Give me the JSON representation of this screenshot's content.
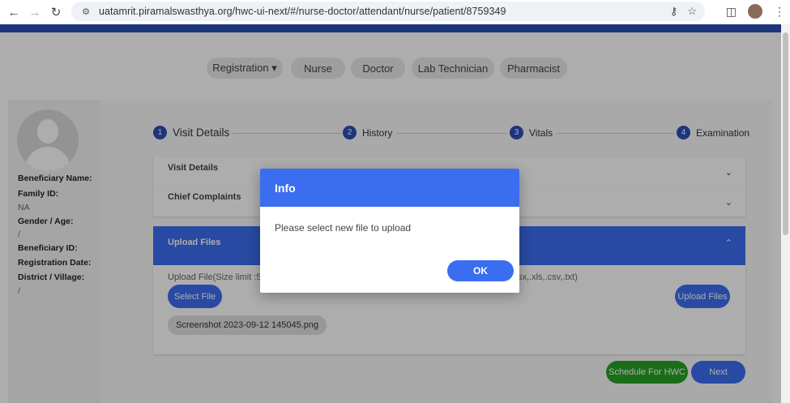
{
  "browser": {
    "url": "uatamrit.piramalswasthya.org/hwc-ui-next/#/nurse-doctor/attendant/nurse/patient/8759349"
  },
  "tabs": [
    "Registration ▾",
    "Nurse",
    "Doctor",
    "Lab Technician",
    "Pharmacist"
  ],
  "beneficiary": {
    "name_label": "Beneficiary Name:",
    "family_label": "Family ID:",
    "family_value": "NA",
    "gender_label": "Gender / Age:",
    "gender_value": "/",
    "benid_label": "Beneficiary ID:",
    "regdate_label": "Registration Date:",
    "district_label": "District / Village:",
    "district_value": "/"
  },
  "steps": [
    {
      "num": "1",
      "label": "Visit Details"
    },
    {
      "num": "2",
      "label": "History"
    },
    {
      "num": "3",
      "label": "Vitals"
    },
    {
      "num": "4",
      "label": "Examination"
    }
  ],
  "sections": {
    "visit_details": "Visit Details",
    "chief_complaints": "Chief Complaints",
    "upload_files": "Upload Files"
  },
  "upload": {
    "hint_left": "Upload File(Size limit :5",
    "hint_right": "sx,.xls,.csv,.txt)",
    "select_label": "Select File",
    "upload_label": "Upload Files",
    "file_name": "Screenshot 2023-09-12 145045.png"
  },
  "actions": {
    "schedule_label": "Schedule For HWC",
    "next_label": "Next"
  },
  "dialog": {
    "title": "Info",
    "message": "Please select new file to upload",
    "ok_label": "OK"
  },
  "colors": {
    "primary": "#3b6df0",
    "header_strip": "#2c4fb4",
    "success": "#27a327"
  }
}
